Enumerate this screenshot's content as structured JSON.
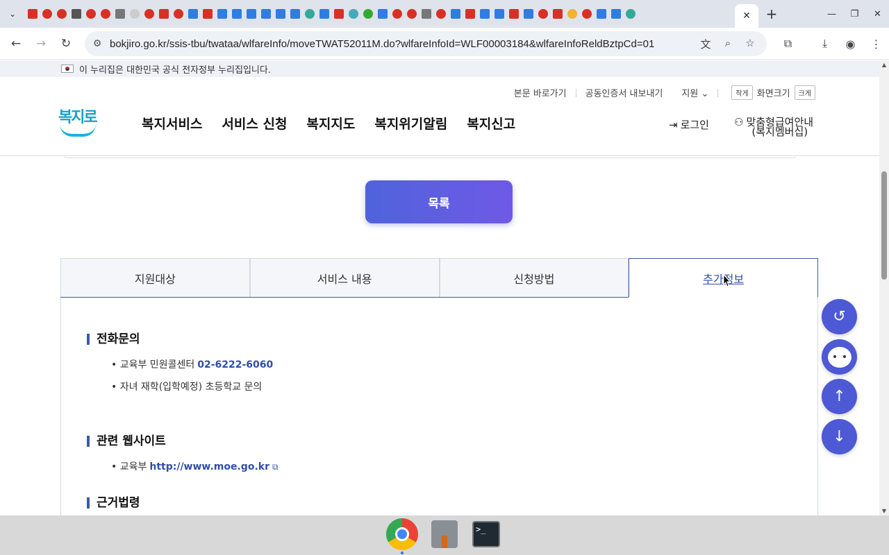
{
  "browser": {
    "tab_icon_colors": [
      "#d93025",
      "#d93025",
      "#d93025",
      "#555",
      "#d93025",
      "#d93025",
      "#777",
      "#ccc",
      "#d93025",
      "#d93025",
      "#d93025",
      "#2f7de1",
      "#d93025",
      "#2f7de1",
      "#2f7de1",
      "#2f7de1",
      "#2f7de1",
      "#2f7de1",
      "#2f7de1",
      "#3a9",
      "#2f7de1",
      "#d93025",
      "#4ab",
      "#3a3",
      "#2f7de1",
      "#d93025",
      "#d93025",
      "#777",
      "#d93025",
      "#2f7de1",
      "#d93025",
      "#2f7de1",
      "#2f7de1",
      "#d93025",
      "#2f7de1",
      "#d93025",
      "#d93025",
      "#f2b233",
      "#d93025",
      "#2f7de1",
      "#2f7de1",
      "#3a9"
    ],
    "active_tab_close": "✕",
    "new_tab": "+",
    "url": "bokjiro.go.kr/ssis-tbu/twataa/wlfareInfo/moveTWAT52011M.do?wlfareInfoId=WLF00003184&wlfareInfoReldBztpCd=01"
  },
  "gov_banner": {
    "text": "이 누리집은 대한민국 공식 전자정부 누리집입니다."
  },
  "header": {
    "util": {
      "skip": "본문 바로가기",
      "cert": "공동인증서 내보내기",
      "region": "지원",
      "small": "작게",
      "screen_size": "화면크기",
      "large": "크게"
    },
    "logo_text": "복지로",
    "nav": [
      "복지서비스",
      "서비스 신청",
      "복지지도",
      "복지위기알림",
      "복지신고"
    ],
    "login": "로그인",
    "member_line1": "맞춤형급여안내",
    "member_line2": "(복지멤버십)"
  },
  "main": {
    "list_button": "목록",
    "tabs": [
      "지원대상",
      "서비스 내용",
      "신청방법",
      "추가정보"
    ],
    "sections": {
      "phone": {
        "title": "전화문의",
        "items": [
          {
            "label": "교육부 민원콜센터",
            "value": "02-6222-6060"
          },
          {
            "label": "자녀 재학(입학예정) 초등학교 문의",
            "value": ""
          }
        ]
      },
      "website": {
        "title": "관련 웹사이트",
        "label": "교육부",
        "link": "http://www.moe.go.kr"
      },
      "law": {
        "title": "근거법령"
      }
    }
  },
  "floating": [
    "history-icon",
    "chatbot-icon",
    "scroll-top-icon",
    "scroll-bottom-icon"
  ],
  "taskbar": [
    "Chrome",
    "Tool",
    "Terminal"
  ]
}
